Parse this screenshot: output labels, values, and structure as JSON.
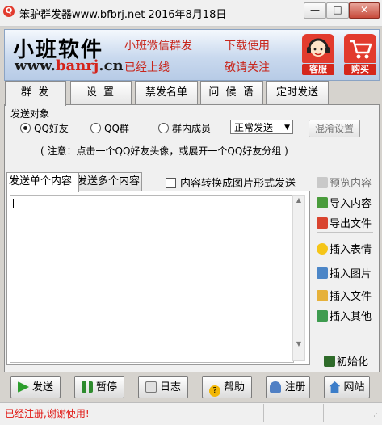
{
  "window": {
    "title": "笨驴群发器www.bfbrj.net 2016年8月18日",
    "min": "—",
    "max": "□",
    "close": "✕"
  },
  "banner": {
    "brand_name": "小班软件",
    "url_prefix": "www.",
    "url_mid": "banrj",
    "url_suffix": ".cn",
    "line1": "小班微信群发",
    "line2": "已经上线",
    "line3": "下载使用",
    "line4": "敬请关注",
    "kefu_label": "客服",
    "buy_label": "购买"
  },
  "tabs": [
    "群 发",
    "设 置",
    "禁发名单",
    "问 候 语",
    "定时发送"
  ],
  "send_target": {
    "label": "发送对象",
    "options": [
      "QQ好友",
      "QQ群",
      "群内成员"
    ],
    "selected_index": 0,
    "mode": "正常发送",
    "mixup_button": "混淆设置",
    "note": "( 注意：点击一个QQ好友头像，或展开一个QQ好友分组 )"
  },
  "content": {
    "subtab_single": "发送单个内容",
    "subtab_multi": "发送多个内容",
    "convert_label": "内容转换成图片形式发送",
    "text": ""
  },
  "side_actions": {
    "preview": "预览内容",
    "import": "导入内容",
    "export": "导出文件",
    "emoji": "插入表情",
    "image": "插入图片",
    "file": "插入文件",
    "other": "插入其他",
    "init": "初始化"
  },
  "bottom": {
    "send": "发送",
    "pause": "暂停",
    "log": "日志",
    "help": "帮助",
    "register": "注册",
    "web": "网站"
  },
  "status": {
    "text": "已经注册,谢谢使用!"
  },
  "colors": {
    "accent_red": "#c8261c",
    "status_red": "#e0140f",
    "banner_blue": "#c9d9ee"
  }
}
